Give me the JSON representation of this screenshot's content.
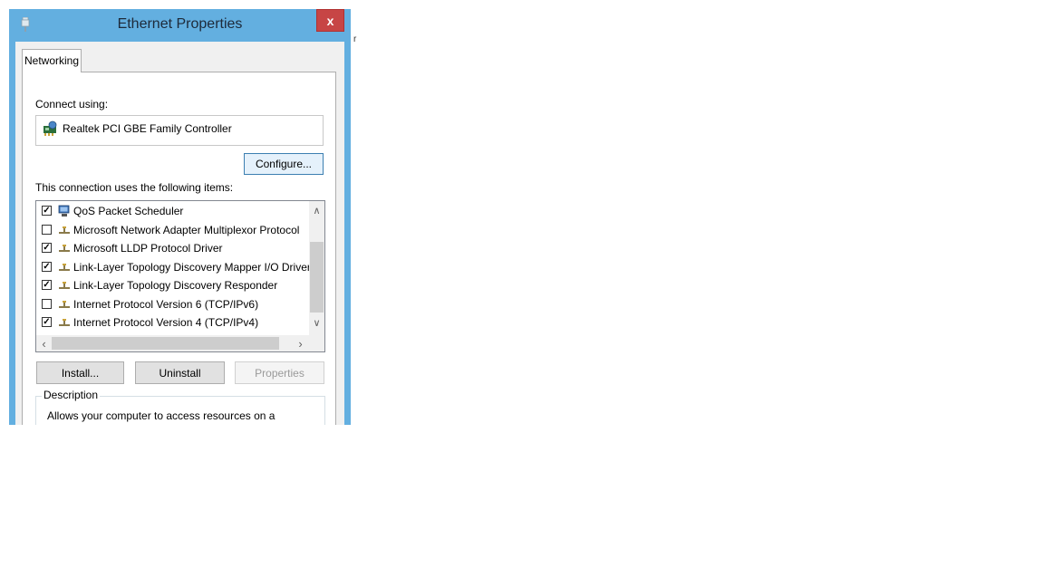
{
  "window": {
    "title": "Ethernet Properties",
    "close_label": "x",
    "accent_color": "#63afe0",
    "close_color": "#c74545"
  },
  "tab": {
    "label": "Networking"
  },
  "connect_using": {
    "label": "Connect using:",
    "adapter_name": "Realtek PCI GBE Family Controller",
    "adapter_icon": "network-adapter-icon"
  },
  "configure_button": "Configure...",
  "items_label": "This connection uses the following items:",
  "items": [
    {
      "label": "QoS Packet Scheduler",
      "checked": true,
      "icon": "scheduler-icon"
    },
    {
      "label": "Microsoft Network Adapter Multiplexor Protocol",
      "checked": false,
      "icon": "protocol-icon"
    },
    {
      "label": "Microsoft LLDP Protocol Driver",
      "checked": true,
      "icon": "protocol-icon"
    },
    {
      "label": "Link-Layer Topology Discovery Mapper I/O Driver",
      "checked": true,
      "icon": "protocol-icon"
    },
    {
      "label": "Link-Layer Topology Discovery Responder",
      "checked": true,
      "icon": "protocol-icon"
    },
    {
      "label": "Internet Protocol Version 6 (TCP/IPv6)",
      "checked": false,
      "icon": "protocol-icon"
    },
    {
      "label": "Internet Protocol Version 4 (TCP/IPv4)",
      "checked": true,
      "icon": "protocol-icon"
    }
  ],
  "buttons": {
    "install": "Install...",
    "uninstall": "Uninstall",
    "properties": "Properties"
  },
  "description": {
    "legend": "Description",
    "text": "Allows your computer to access resources on a Microsoft network."
  },
  "stray_mark": "r"
}
